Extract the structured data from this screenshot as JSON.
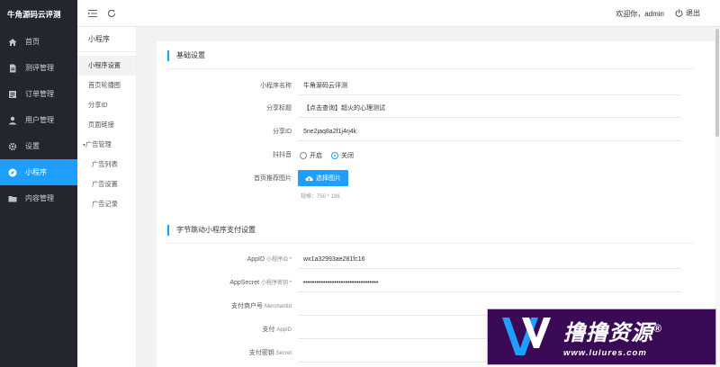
{
  "app": {
    "brand": "牛角源码云评测"
  },
  "header": {
    "welcome": "欢迎你，admin",
    "logout_label": "退出"
  },
  "sidebar": {
    "items": [
      {
        "label": "首页",
        "icon": "home-icon"
      },
      {
        "label": "测评管理",
        "icon": "file-icon"
      },
      {
        "label": "订单管理",
        "icon": "list-icon"
      },
      {
        "label": "用户管理",
        "icon": "user-icon"
      },
      {
        "label": "设置",
        "icon": "gear-icon"
      },
      {
        "label": "小程序",
        "icon": "compass-icon",
        "active": true
      },
      {
        "label": "内容管理",
        "icon": "folder-icon"
      }
    ]
  },
  "subnav": {
    "title": "小程序",
    "items": [
      {
        "label": "小程序设置",
        "active": true
      },
      {
        "label": "首页轮播图"
      },
      {
        "label": "分享ID"
      },
      {
        "label": "页面链接"
      },
      {
        "label": "广告管理",
        "expanded": true
      },
      {
        "label": "广告列表"
      },
      {
        "label": "广告设置"
      },
      {
        "label": "广告记录"
      }
    ]
  },
  "basic": {
    "section_title": "基础设置",
    "name_label": "小程序名称",
    "name_value": "牛角源码云评测",
    "share_title_label": "分享标题",
    "share_title_value": "【点击查询】超火的心理测试",
    "share_id_label": "分享ID",
    "share_id_value": "5ne2jaq8a2f1j4rj4k",
    "douyin_label": "抖抖音",
    "radio_on_label": "开启",
    "radio_off_label": "关闭",
    "radio_selected": "关闭",
    "image_label": "首页推荐图片",
    "upload_label": "选择图片",
    "image_hint": "规格：750 * 186"
  },
  "pay": {
    "section_title": "字节跳动小程序支付设置",
    "appid_label": "AppID",
    "appid_sub": "小程序ID *",
    "appid_value": "wx1a32993ae281fc16",
    "secret_label": "AppSecret",
    "secret_sub": "小程序密钥 *",
    "secret_value": "••••••••••••••••••••••••••••••••••",
    "merchant_label": "支付商户号",
    "merchant_sub": "MerchantId",
    "merchant_value": "",
    "pay_appid_label": "支付",
    "pay_appid_sub": "AppID",
    "pay_appid_value": "",
    "pay_secret_label": "支付密钥",
    "pay_secret_sub": "Secret",
    "pay_secret_value": ""
  },
  "watermark": {
    "title": "撸撸资源",
    "reg": "®",
    "url": "www.lulures.com"
  },
  "colors": {
    "accent": "#1e9fff",
    "sidebar_bg": "#23262e",
    "watermark_bg": "#3b0a57"
  }
}
